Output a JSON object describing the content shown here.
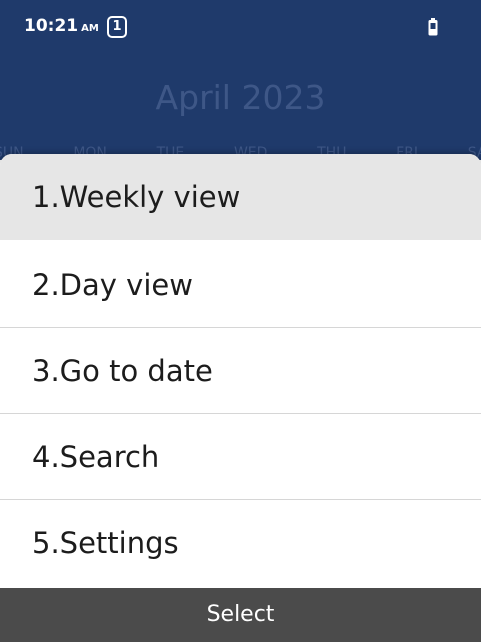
{
  "status_bar": {
    "time": "10:21",
    "ampm": "AM",
    "notification_count": "1",
    "battery_icon": "battery-icon"
  },
  "calendar": {
    "month_title": "April 2023",
    "weekdays": [
      "SUN",
      "MON",
      "TUE",
      "WED",
      "THU",
      "FRI",
      "SAT"
    ]
  },
  "menu": {
    "items": [
      {
        "label": "1.Weekly view",
        "selected": true
      },
      {
        "label": "2.Day view",
        "selected": false
      },
      {
        "label": "3.Go to date",
        "selected": false
      },
      {
        "label": "4.Search",
        "selected": false
      },
      {
        "label": "5.Settings",
        "selected": false
      }
    ]
  },
  "softkeys": {
    "center": "Select"
  },
  "colors": {
    "header_bg": "#1f3a6b",
    "selected_bg": "#e6e6e6",
    "softkey_bg": "#4b4b4b"
  }
}
